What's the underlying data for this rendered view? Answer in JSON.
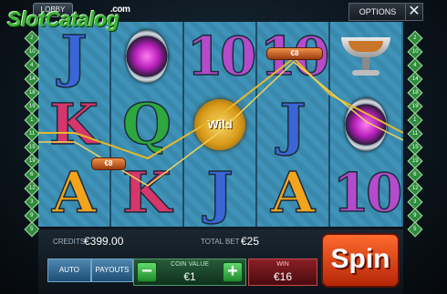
{
  "watermark": {
    "text": "SlotCatalog",
    "suffix": ".com"
  },
  "topbar": {
    "lobby_label": "LOBBY",
    "options_label": "OPTIONS",
    "close_glyph": "✕"
  },
  "reels": [
    [
      "J",
      "K",
      "A"
    ],
    [
      "gem",
      "Q",
      "K"
    ],
    [
      "10",
      "wild",
      "J"
    ],
    [
      "10",
      "J",
      "A"
    ],
    [
      "cup",
      "gem",
      "10"
    ]
  ],
  "wild_label": "Wild",
  "paylines_win": [
    {
      "label": "€8"
    },
    {
      "label": "€8"
    }
  ],
  "left_markers": [
    "2",
    "10",
    "4",
    "14",
    "18",
    "19",
    "1",
    "11",
    "15",
    "19",
    "6",
    "12",
    "3",
    "9",
    "5"
  ],
  "right_markers": [
    "2",
    "10",
    "4",
    "14",
    "18",
    "19",
    "1",
    "11",
    "15",
    "19",
    "6",
    "12",
    "3",
    "9",
    "5"
  ],
  "bottom": {
    "credits_label": "CREDITS",
    "credits_value": "€399.00",
    "total_bet_label": "TOTAL BET",
    "total_bet_value": "€25",
    "auto_label": "AUTO",
    "payouts_label": "PAYOUTS",
    "coin_value_label": "COIN VALUE",
    "coin_value": "€1",
    "minus_label": "−",
    "plus_label": "+",
    "win_label": "WIN",
    "win_value": "€16",
    "spin_label": "Spin"
  },
  "colors": {
    "accent": "#f2a51c",
    "spin": "#e24a17",
    "reel_bg": "#3f93b8"
  }
}
